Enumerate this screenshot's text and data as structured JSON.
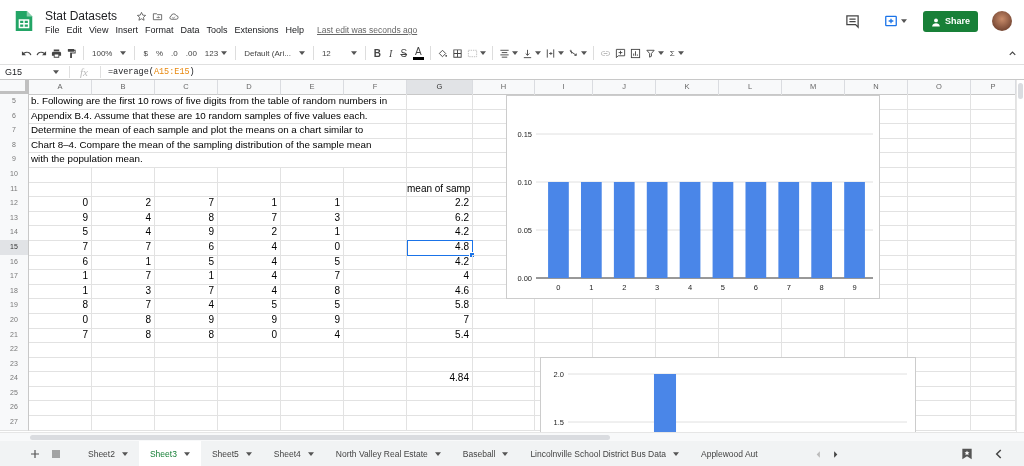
{
  "app": {
    "title": "Stat Datasets",
    "menu": [
      "File",
      "Edit",
      "View",
      "Insert",
      "Format",
      "Data",
      "Tools",
      "Extensions",
      "Help"
    ],
    "last_edit": "Last edit was seconds ago",
    "share_label": "Share"
  },
  "toolbar": {
    "zoom": "100%",
    "currency": "$",
    "percent": "%",
    "decrease_decimals": ".0",
    "increase_decimals": ".00",
    "number_format": "123",
    "font": "Default (Ari...",
    "font_size": "12",
    "bold": "B",
    "italic": "I",
    "strikethrough": "S",
    "text_color": "A",
    "functions": "Σ"
  },
  "formula_bar": {
    "cell_ref": "G15",
    "fx": "fx",
    "formula": [
      {
        "text": "=average(",
        "kind": "plain"
      },
      {
        "text": "A15:E15",
        "kind": "range"
      },
      {
        "text": ")",
        "kind": "plain"
      }
    ]
  },
  "grid": {
    "columns": [
      {
        "label": "A",
        "selected": false
      },
      {
        "label": "B",
        "selected": false
      },
      {
        "label": "C",
        "selected": false
      },
      {
        "label": "D",
        "selected": false
      },
      {
        "label": "E",
        "selected": false
      },
      {
        "label": "F",
        "selected": false
      },
      {
        "label": "G",
        "selected": true
      },
      {
        "label": "H",
        "selected": false
      },
      {
        "label": "I",
        "selected": false
      },
      {
        "label": "J",
        "selected": false
      },
      {
        "label": "K",
        "selected": false
      },
      {
        "label": "L",
        "selected": false
      },
      {
        "label": "M",
        "selected": false
      },
      {
        "label": "N",
        "selected": false
      },
      {
        "label": "O",
        "selected": false
      },
      {
        "label": "P",
        "selected": false
      }
    ],
    "rows": [
      {
        "number": "5",
        "selected": false,
        "note": "b. Following are the first 10 rows of five digits from the table of random numbers in"
      },
      {
        "number": "6",
        "selected": false,
        "note": "Appendix B.4. Assume that these are 10 random samples of five values each."
      },
      {
        "number": "7",
        "selected": false,
        "note": "Determine the mean of each sample and plot the means on a chart similar to"
      },
      {
        "number": "8",
        "selected": false,
        "note": "Chart 8–4. Compare the mean of the sampling distribution of the sample mean"
      },
      {
        "number": "9",
        "selected": false,
        "note": "with the population mean."
      },
      {
        "number": "10",
        "selected": false
      },
      {
        "number": "11",
        "selected": false,
        "mean": "mean of samp",
        "mean_selected": false
      },
      {
        "number": "12",
        "selected": false,
        "samples": [
          "0",
          "2",
          "7",
          "1",
          "1"
        ],
        "mean": "2.2",
        "mean_selected": false
      },
      {
        "number": "13",
        "selected": false,
        "samples": [
          "9",
          "4",
          "8",
          "7",
          "3"
        ],
        "mean": "6.2",
        "mean_selected": false
      },
      {
        "number": "14",
        "selected": false,
        "samples": [
          "5",
          "4",
          "9",
          "2",
          "1"
        ],
        "mean": "4.2",
        "mean_selected": false
      },
      {
        "number": "15",
        "selected": true,
        "samples": [
          "7",
          "7",
          "6",
          "4",
          "0"
        ],
        "mean": "4.8",
        "mean_selected": true
      },
      {
        "number": "16",
        "selected": false,
        "samples": [
          "6",
          "1",
          "5",
          "4",
          "5"
        ],
        "mean": "4.2",
        "mean_selected": false
      },
      {
        "number": "17",
        "selected": false,
        "samples": [
          "1",
          "7",
          "1",
          "4",
          "7"
        ],
        "mean": "4",
        "mean_selected": false
      },
      {
        "number": "18",
        "selected": false,
        "samples": [
          "1",
          "3",
          "7",
          "4",
          "8"
        ],
        "mean": "4.6",
        "mean_selected": false
      },
      {
        "number": "19",
        "selected": false,
        "samples": [
          "8",
          "7",
          "4",
          "5",
          "5"
        ],
        "mean": "5.8",
        "mean_selected": false
      },
      {
        "number": "20",
        "selected": false,
        "samples": [
          "0",
          "8",
          "9",
          "9",
          "9"
        ],
        "mean": "7",
        "mean_selected": false
      },
      {
        "number": "21",
        "selected": false,
        "samples": [
          "7",
          "8",
          "8",
          "0",
          "4"
        ],
        "mean": "5.4",
        "mean_selected": false
      },
      {
        "number": "22",
        "selected": false
      },
      {
        "number": "23",
        "selected": false
      },
      {
        "number": "24",
        "selected": false,
        "mean": "4.84",
        "mean_selected": false
      },
      {
        "number": "25",
        "selected": false
      },
      {
        "number": "26",
        "selected": false
      },
      {
        "number": "27",
        "selected": false
      }
    ]
  },
  "charts": [
    {
      "chart_data": {
        "type": "bar",
        "categories": [
          "0",
          "1",
          "2",
          "3",
          "4",
          "5",
          "6",
          "7",
          "8",
          "9"
        ],
        "series": [
          {
            "color": "#4a86e8",
            "values": [
              0.1,
              0.1,
              0.1,
              0.1,
              0.1,
              0.1,
              0.1,
              0.1,
              0.1,
              0.1
            ]
          }
        ],
        "ylim": [
          0,
          0.15
        ],
        "yticks": [
          {
            "value": 0,
            "label": "0.00"
          },
          {
            "value": 0.05,
            "label": "0.05"
          },
          {
            "value": 0.1,
            "label": "0.10"
          },
          {
            "value": 0.15,
            "label": "0.15"
          }
        ]
      }
    },
    {
      "chart_data": {
        "type": "bar",
        "categories": [
          null
        ],
        "series": [
          {
            "color": "#4a86e8",
            "values": [
              2
            ]
          }
        ],
        "ylim": [
          1.375,
          2.0
        ],
        "yticks": [
          {
            "value": 1.5,
            "label": "1.5"
          },
          {
            "value": 2,
            "label": "2.0"
          }
        ]
      }
    }
  ],
  "sheet_tabs": [
    {
      "label": "Sheet2",
      "selected": false
    },
    {
      "label": "Sheet3",
      "selected": true
    },
    {
      "label": "Sheet5",
      "selected": false
    },
    {
      "label": "Sheet4",
      "selected": false
    },
    {
      "label": "North Valley Real Estate",
      "selected": false
    },
    {
      "label": "Baseball",
      "selected": false
    },
    {
      "label": "Lincolnville School District Bus Data",
      "selected": false
    },
    {
      "label": "Applewood Aut",
      "selected": false
    }
  ]
}
